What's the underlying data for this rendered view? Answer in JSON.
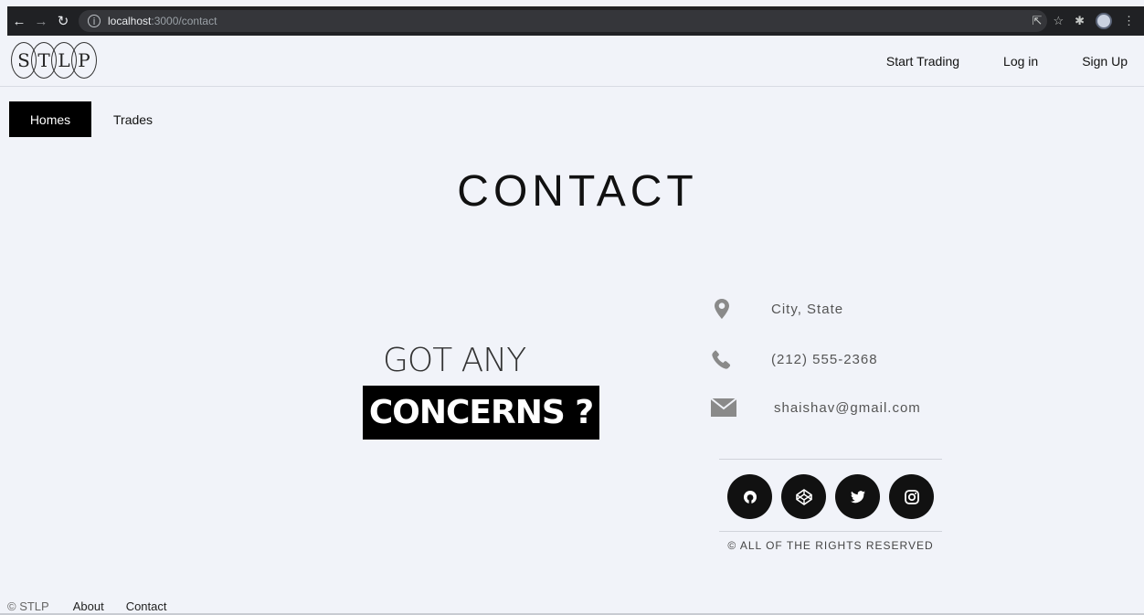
{
  "browser": {
    "url_host": "localhost",
    "url_path": ":3000/contact",
    "info_glyph": "i"
  },
  "header": {
    "logo_letters": [
      "S",
      "T",
      "L",
      "P"
    ],
    "links": [
      "Start Trading",
      "Log in",
      "Sign Up"
    ]
  },
  "tabs": {
    "active": "Homes",
    "other": "Trades"
  },
  "main": {
    "title": "CONTACT",
    "tagline_top": "GOT ANY",
    "tagline_highlight": "CONCERNS ?"
  },
  "contact": {
    "location": "City, State",
    "phone": "(212) 555-2368",
    "email": "shaishav@gmail.com",
    "icon_color": "#8a8a8a"
  },
  "socials": [
    "github-icon",
    "codepen-icon",
    "twitter-icon",
    "instagram-icon"
  ],
  "rights": "© ALL OF THE RIGHTS RESERVED",
  "footer": {
    "copy": "© STLP",
    "about": "About",
    "contact": "Contact"
  }
}
